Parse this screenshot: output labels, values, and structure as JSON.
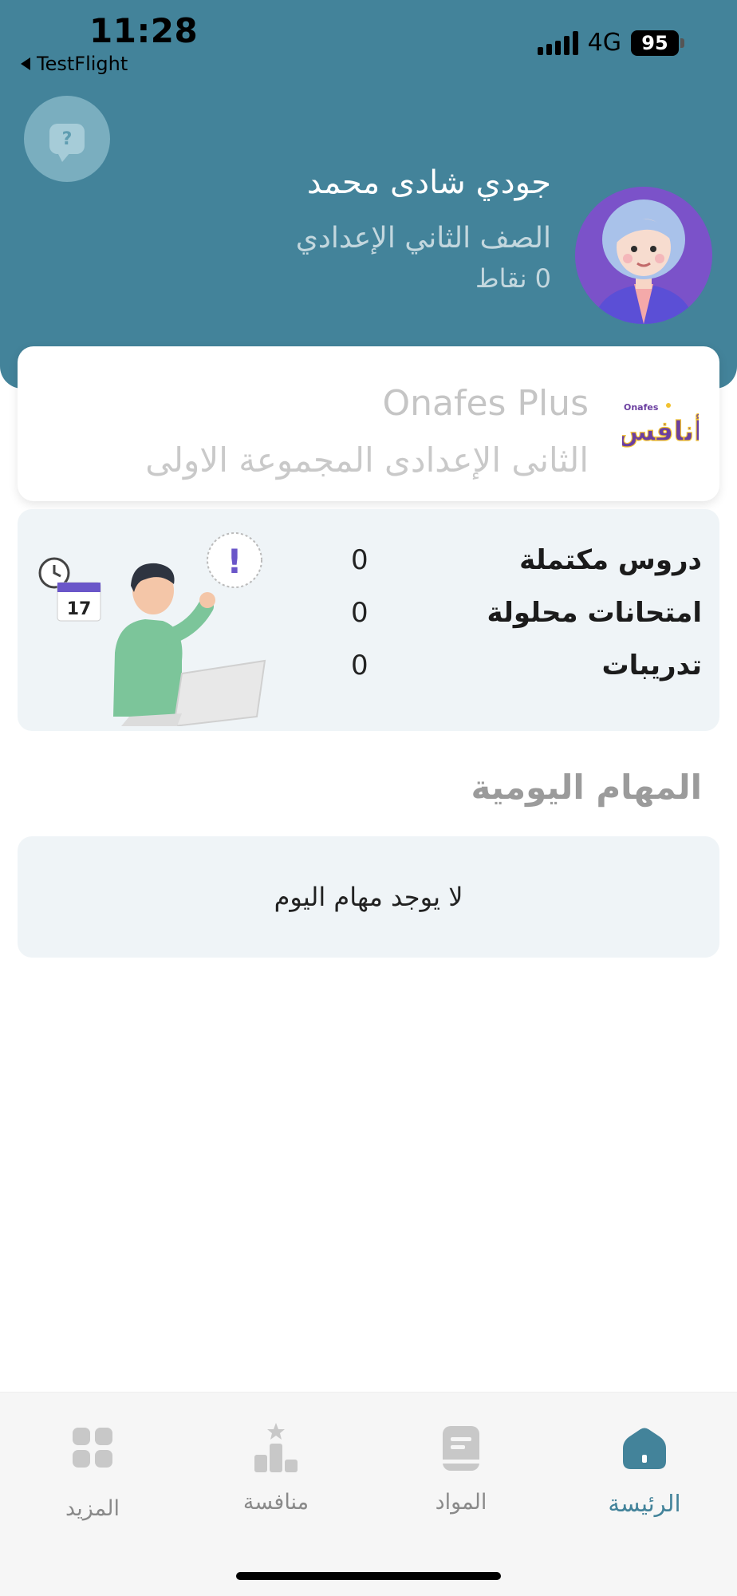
{
  "status_bar": {
    "time": "11:28",
    "back_app": "TestFlight",
    "network": "4G",
    "battery": "95"
  },
  "profile": {
    "name": "جودي شادى محمد",
    "grade": "الصف الثاني الإعدادي",
    "points": "0 نقاط",
    "help_icon": "question-chat-icon"
  },
  "group": {
    "title": "Onafes Plus",
    "subtitle": "الثانى الإعدادى المجموعة الاولى",
    "logo_text": "Onafes",
    "logo_arabic": "أنافس"
  },
  "stats": [
    {
      "label": "دروس مكتملة",
      "value": "0"
    },
    {
      "label": "امتحانات محلولة",
      "value": "0"
    },
    {
      "label": "تدريبات",
      "value": "0"
    }
  ],
  "illustration": {
    "calendar_day": "17",
    "exclamation": "!"
  },
  "daily_tasks": {
    "heading": "المهام اليومية",
    "empty_message": "لا يوجد مهام اليوم"
  },
  "nav": {
    "home": {
      "label": "الرئيسة",
      "icon": "home-icon"
    },
    "subjects": {
      "label": "المواد",
      "icon": "book-icon"
    },
    "competition": {
      "label": "منافسة",
      "icon": "podium-icon"
    },
    "more": {
      "label": "المزيد",
      "icon": "grid-icon"
    }
  },
  "colors": {
    "primary": "#43839a",
    "card_bg": "#eff4f7",
    "avatar_bg": "#7b52c9"
  }
}
